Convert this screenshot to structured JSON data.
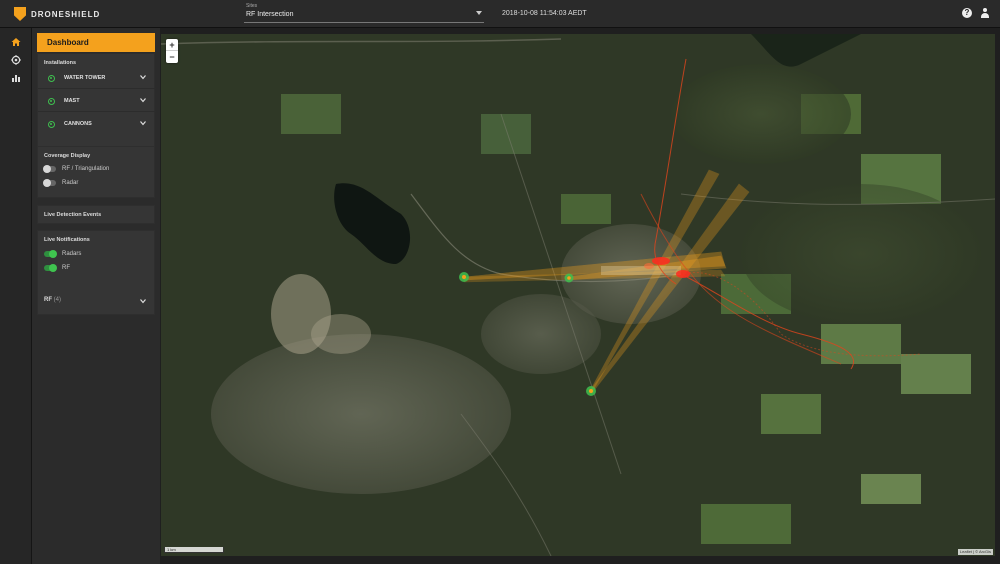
{
  "header": {
    "logo_text": "DRONESHIELD",
    "site_label": "Sites",
    "site_value": "RF Intersection",
    "timestamp": "2018-10-08 11:54:03 AEDT"
  },
  "nav": [
    "home-icon",
    "target-icon",
    "chart-icon"
  ],
  "sidebar": {
    "dashboard_label": "Dashboard",
    "installations": {
      "title": "Installations",
      "items": [
        {
          "label": "WATER TOWER"
        },
        {
          "label": "MAST"
        },
        {
          "label": "CANNONS"
        }
      ]
    },
    "coverage": {
      "title": "Coverage Display",
      "options": [
        {
          "label": "RF / Triangulation",
          "on": false
        },
        {
          "label": "Radar",
          "on": false
        }
      ]
    },
    "live_detection": {
      "title": "Live Detection Events"
    },
    "notifications": {
      "title": "Live Notifications",
      "options": [
        {
          "label": "Radars",
          "on": true
        },
        {
          "label": "RF",
          "on": true
        }
      ],
      "rf_label": "RF",
      "rf_count": "(4)"
    }
  },
  "map": {
    "zoom_in": "+",
    "zoom_out": "−",
    "scale": "1 km",
    "attribution": "Leaflet | © ArcGis",
    "colors": {
      "beam": "#f4a11d",
      "track": "#e0451d",
      "sensor": "#3fbf4f"
    }
  }
}
